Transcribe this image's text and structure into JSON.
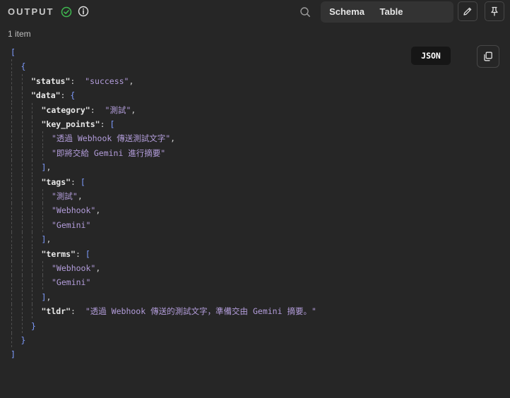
{
  "header": {
    "title": "OUTPUT",
    "tabs": [
      {
        "label": "Schema",
        "active": false
      },
      {
        "label": "Table",
        "active": false
      },
      {
        "label": "JSON",
        "active": true
      }
    ],
    "status_color": "#3fb950"
  },
  "item_count": "1 item",
  "json_view": {
    "lines": [
      {
        "depth": 0,
        "parts": [
          {
            "t": "[",
            "c": "b"
          }
        ]
      },
      {
        "depth": 1,
        "parts": [
          {
            "t": "{",
            "c": "b"
          }
        ]
      },
      {
        "depth": 2,
        "parts": [
          {
            "t": "\"status\"",
            "c": "k"
          },
          {
            "t": ":  ",
            "c": "p"
          },
          {
            "t": "\"success\"",
            "c": "s"
          },
          {
            "t": ",",
            "c": "p"
          }
        ]
      },
      {
        "depth": 2,
        "parts": [
          {
            "t": "\"data\"",
            "c": "k"
          },
          {
            "t": ": ",
            "c": "p"
          },
          {
            "t": "{",
            "c": "b"
          }
        ]
      },
      {
        "depth": 3,
        "parts": [
          {
            "t": "\"category\"",
            "c": "k"
          },
          {
            "t": ":  ",
            "c": "p"
          },
          {
            "t": "\"測試\"",
            "c": "s"
          },
          {
            "t": ",",
            "c": "p"
          }
        ]
      },
      {
        "depth": 3,
        "parts": [
          {
            "t": "\"key_points\"",
            "c": "k"
          },
          {
            "t": ": ",
            "c": "p"
          },
          {
            "t": "[",
            "c": "b"
          }
        ]
      },
      {
        "depth": 4,
        "parts": [
          {
            "t": "\"透過 Webhook 傳送測試文字\"",
            "c": "s"
          },
          {
            "t": ",",
            "c": "p"
          }
        ]
      },
      {
        "depth": 4,
        "parts": [
          {
            "t": "\"即將交給 Gemini 進行摘要\"",
            "c": "s"
          }
        ]
      },
      {
        "depth": 3,
        "parts": [
          {
            "t": "]",
            "c": "b"
          },
          {
            "t": ",",
            "c": "p"
          }
        ]
      },
      {
        "depth": 3,
        "parts": [
          {
            "t": "\"tags\"",
            "c": "k"
          },
          {
            "t": ": ",
            "c": "p"
          },
          {
            "t": "[",
            "c": "b"
          }
        ]
      },
      {
        "depth": 4,
        "parts": [
          {
            "t": "\"測試\"",
            "c": "s"
          },
          {
            "t": ",",
            "c": "p"
          }
        ]
      },
      {
        "depth": 4,
        "parts": [
          {
            "t": "\"Webhook\"",
            "c": "s"
          },
          {
            "t": ",",
            "c": "p"
          }
        ]
      },
      {
        "depth": 4,
        "parts": [
          {
            "t": "\"Gemini\"",
            "c": "s"
          }
        ]
      },
      {
        "depth": 3,
        "parts": [
          {
            "t": "]",
            "c": "b"
          },
          {
            "t": ",",
            "c": "p"
          }
        ]
      },
      {
        "depth": 3,
        "parts": [
          {
            "t": "\"terms\"",
            "c": "k"
          },
          {
            "t": ": ",
            "c": "p"
          },
          {
            "t": "[",
            "c": "b"
          }
        ]
      },
      {
        "depth": 4,
        "parts": [
          {
            "t": "\"Webhook\"",
            "c": "s"
          },
          {
            "t": ",",
            "c": "p"
          }
        ]
      },
      {
        "depth": 4,
        "parts": [
          {
            "t": "\"Gemini\"",
            "c": "s"
          }
        ]
      },
      {
        "depth": 3,
        "parts": [
          {
            "t": "]",
            "c": "b"
          },
          {
            "t": ",",
            "c": "p"
          }
        ]
      },
      {
        "depth": 3,
        "parts": [
          {
            "t": "\"tldr\"",
            "c": "k"
          },
          {
            "t": ":  ",
            "c": "p"
          },
          {
            "t": "\"透過 Webhook 傳送的測試文字，準備交由 Gemini 摘要。\"",
            "c": "s"
          }
        ]
      },
      {
        "depth": 2,
        "parts": [
          {
            "t": "}",
            "c": "b"
          }
        ]
      },
      {
        "depth": 1,
        "parts": [
          {
            "t": "}",
            "c": "b"
          }
        ]
      },
      {
        "depth": 0,
        "parts": [
          {
            "t": "]",
            "c": "b"
          }
        ]
      }
    ]
  }
}
